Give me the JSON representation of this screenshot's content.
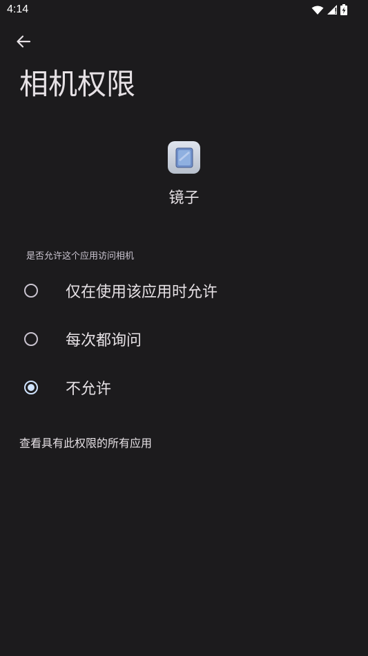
{
  "status_bar": {
    "time": "4:14",
    "icons": [
      "wifi-icon",
      "signal-icon",
      "battery-icon"
    ]
  },
  "header": {
    "back_icon": "back-arrow-icon",
    "title": "相机权限"
  },
  "app": {
    "icon": "mirror-app-icon",
    "name": "镜子"
  },
  "permission": {
    "section_header": "是否允许这个应用访问相机",
    "options": [
      {
        "label": "仅在使用该应用时允许",
        "checked": false
      },
      {
        "label": "每次都询问",
        "checked": false
      },
      {
        "label": "不允许",
        "checked": true
      }
    ]
  },
  "footer": {
    "view_all_link": "查看具有此权限的所有应用"
  },
  "colors": {
    "background": "#1c1b1d",
    "text": "#e6e1e5",
    "radio_accent": "#d0e4ff"
  }
}
